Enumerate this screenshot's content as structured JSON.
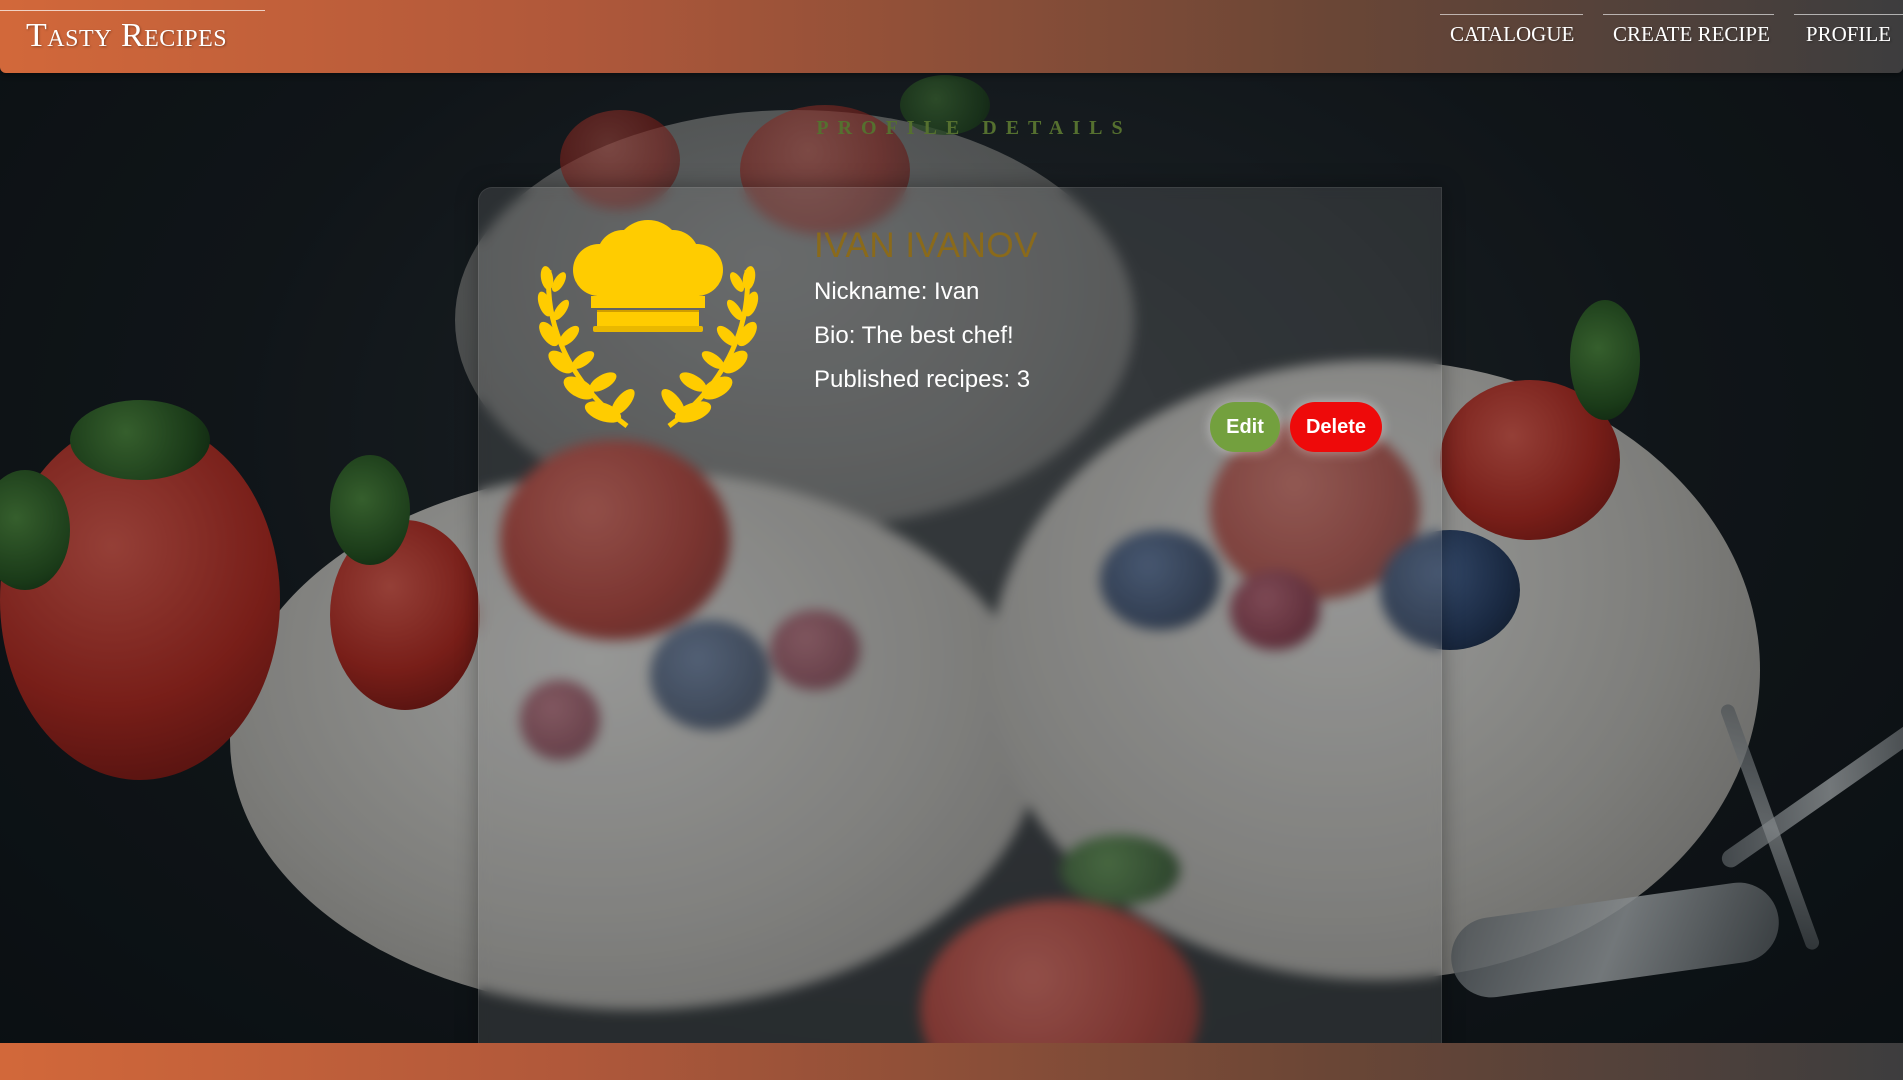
{
  "header": {
    "brand": "Tasty Recipes",
    "nav": [
      {
        "label": "CATALOGUE"
      },
      {
        "label": "CREATE RECIPE"
      },
      {
        "label": "PROFILE"
      }
    ]
  },
  "page": {
    "title": "PROFILE DETAILS"
  },
  "profile": {
    "name": "IVAN IVANOV",
    "nickname": "Nickname: Ivan",
    "bio": "Bio: The best chef!",
    "recipes": "Published recipes: 3",
    "avatar_icon": "chef-hat-laurel-icon",
    "accent_color": "#ffcc00"
  },
  "actions": {
    "edit_label": "Edit",
    "delete_label": "Delete",
    "edit_color": "#73a03e",
    "delete_color": "#ee0a0a"
  },
  "footer": {
    "text": ""
  }
}
